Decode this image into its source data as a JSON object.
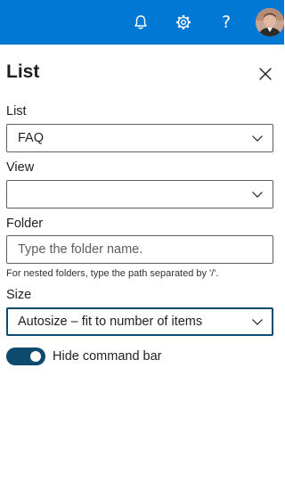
{
  "topbar": {
    "background": "#0078d4",
    "notifications_icon": "bell-icon",
    "settings_icon": "gear-icon",
    "help_icon": "question-icon",
    "help_glyph": "?"
  },
  "panel": {
    "title": "List",
    "close_icon": "close-icon"
  },
  "fields": {
    "list": {
      "label": "List",
      "value": "FAQ"
    },
    "view": {
      "label": "View",
      "value": ""
    },
    "folder": {
      "label": "Folder",
      "placeholder": "Type the folder name.",
      "hint": "For nested folders, type the path separated by '/'."
    },
    "size": {
      "label": "Size",
      "value": "Autosize – fit to number of items"
    }
  },
  "toggle": {
    "label": "Hide command bar",
    "on": true,
    "color": "#0e4a6d"
  }
}
